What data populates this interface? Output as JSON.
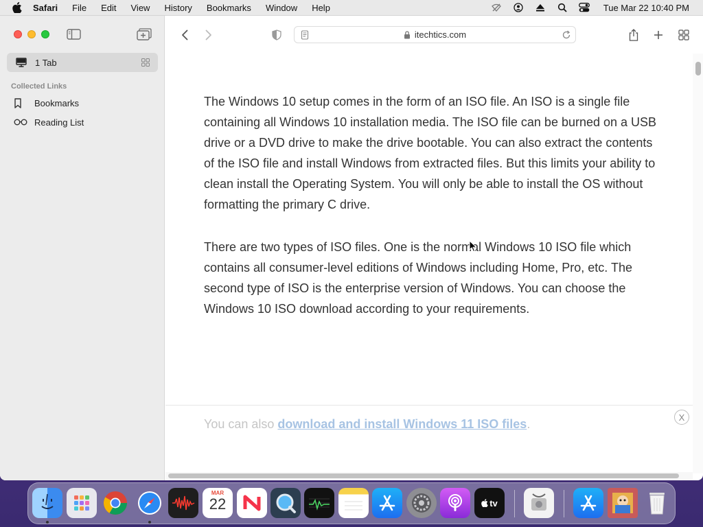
{
  "menubar": {
    "app_name": "Safari",
    "items": [
      "File",
      "Edit",
      "View",
      "History",
      "Bookmarks",
      "Window",
      "Help"
    ],
    "clock": "Tue Mar 22  10:40 PM"
  },
  "sidebar": {
    "tab_label": "1 Tab",
    "section_label": "Collected Links",
    "bookmarks_label": "Bookmarks",
    "reading_list_label": "Reading List"
  },
  "toolbar": {
    "url": "itechtics.com"
  },
  "article": {
    "paragraph1": "The Windows 10 setup comes in the form of an ISO file. An ISO is a single file containing all Windows 10 installation media. The ISO file can be burned on a USB drive or a DVD drive to make the drive bootable. You can also extract the contents of the ISO file and install Windows from extracted files. But this limits your ability to clean install the Operating System. You will only be able to install the OS without formatting the primary C drive.",
    "paragraph2": "There are two types of ISO files. One is the normal Windows 10 ISO file which contains all consumer-level editions of Windows including Home, Pro, etc. The second type of ISO is the enterprise version of Windows. You can choose the Windows 10 ISO download according to your requirements."
  },
  "banner": {
    "prefix": "You can also ",
    "link": "download and install Windows 11 ISO files",
    "suffix": ".",
    "close": "X"
  },
  "dock": {
    "calendar_month": "MAR",
    "calendar_day": "22",
    "tv_label": "tv"
  }
}
